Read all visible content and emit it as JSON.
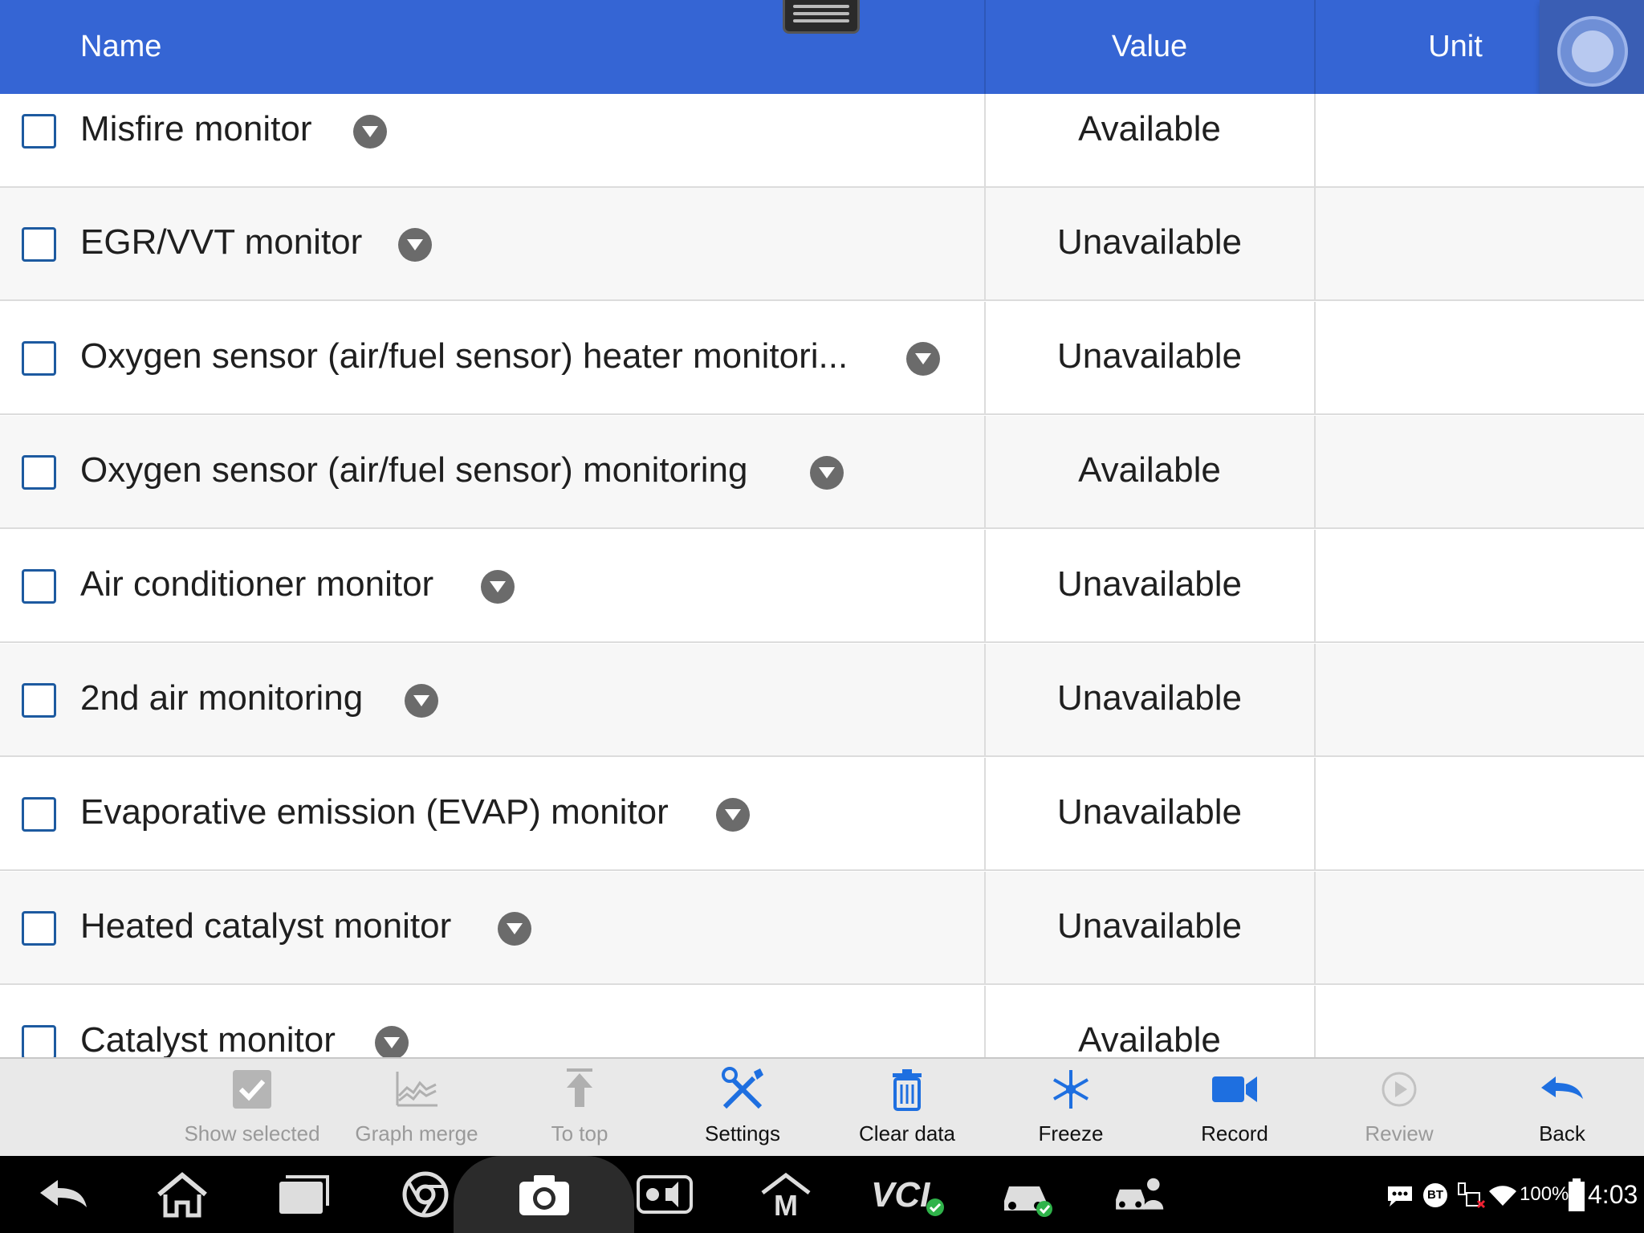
{
  "header": {
    "name_label": "Name",
    "value_label": "Value",
    "unit_label": "Unit",
    "color": "#3565d4"
  },
  "rows": [
    {
      "name": "Misfire monitor",
      "value": "Available",
      "unit": ""
    },
    {
      "name": "EGR/VVT monitor",
      "value": "Unavailable",
      "unit": ""
    },
    {
      "name": "Oxygen sensor (air/fuel sensor) heater monitori...",
      "value": "Unavailable",
      "unit": ""
    },
    {
      "name": "Oxygen sensor (air/fuel sensor) monitoring",
      "value": "Available",
      "unit": ""
    },
    {
      "name": "Air conditioner monitor",
      "value": "Unavailable",
      "unit": ""
    },
    {
      "name": "2nd air monitoring",
      "value": "Unavailable",
      "unit": ""
    },
    {
      "name": "Evaporative emission (EVAP) monitor",
      "value": "Unavailable",
      "unit": ""
    },
    {
      "name": "Heated catalyst monitor",
      "value": "Unavailable",
      "unit": ""
    },
    {
      "name": "Catalyst monitor",
      "value": "Available",
      "unit": ""
    }
  ],
  "toolbar": {
    "show_selected": "Show selected",
    "graph_merge": "Graph merge",
    "to_top": "To top",
    "settings": "Settings",
    "clear_data": "Clear data",
    "freeze": "Freeze",
    "record": "Record",
    "review": "Review",
    "back": "Back",
    "accent_color": "#1e6fe0"
  },
  "navbar": {
    "vci_label": "VCI",
    "battery": "100%",
    "time": "4:03",
    "bt_label": "BT"
  }
}
